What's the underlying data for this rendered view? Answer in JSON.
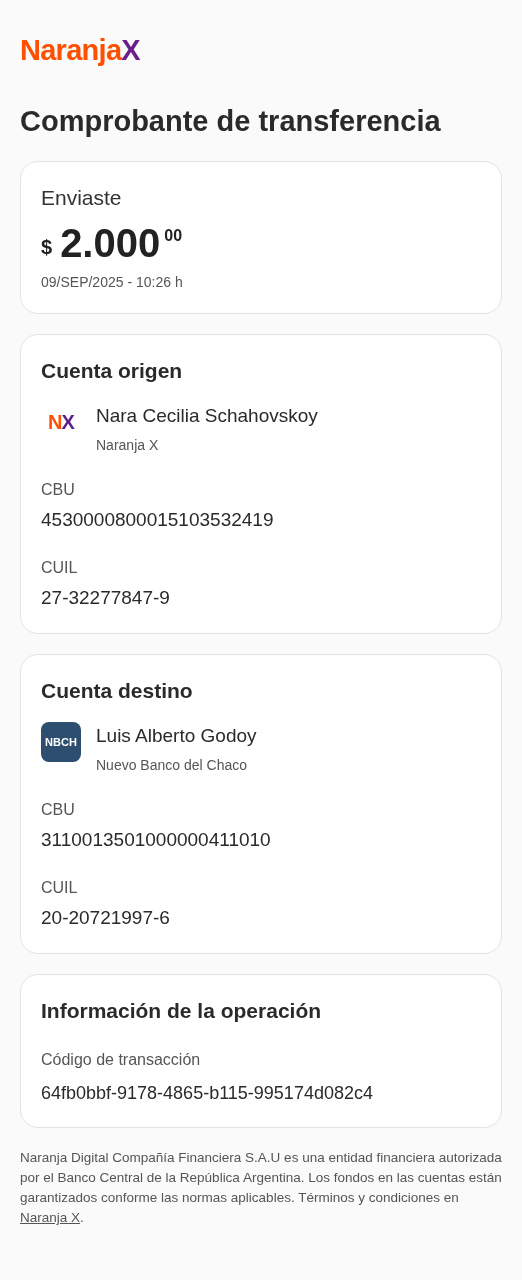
{
  "logo": "NaranjaX",
  "title": "Comprobante de transferencia",
  "amount_card": {
    "label": "Enviaste",
    "currency": "$",
    "amount": "2.000",
    "cents": "00",
    "datetime": "09/SEP/2025 - 10:26 h"
  },
  "accounts": [
    {
      "heading": "Cuenta origen",
      "kind": "nx",
      "logo_text": "NX",
      "name": "Nara Cecilia Schahovskoy",
      "bank": "Naranja X",
      "fields": [
        {
          "label": "CBU",
          "value": "4530000800015103532419"
        },
        {
          "label": "CUIL",
          "value": "27-32277847-9"
        }
      ]
    },
    {
      "heading": "Cuenta destino",
      "kind": "bank",
      "logo_text": "NBCH",
      "name": "Luis Alberto Godoy",
      "bank": "Nuevo Banco del Chaco",
      "fields": [
        {
          "label": "CBU",
          "value": "3110013501000000411010"
        },
        {
          "label": "CUIL",
          "value": "20-20721997-6"
        }
      ]
    }
  ],
  "operation": {
    "heading": "Información de la operación",
    "label": "Código de transacción",
    "value": "64fb0bbf-9178-4865-b115-995174d082c4"
  },
  "footer": {
    "text": "Naranja Digital Compañía Financiera S.A.U es una entidad financiera autorizada por el Banco Central de la República Argentina. Los fondos en las cuentas están garantizados conforme las normas aplicables. Términos y condiciones en ",
    "link": "Naranja X",
    "after": "."
  }
}
